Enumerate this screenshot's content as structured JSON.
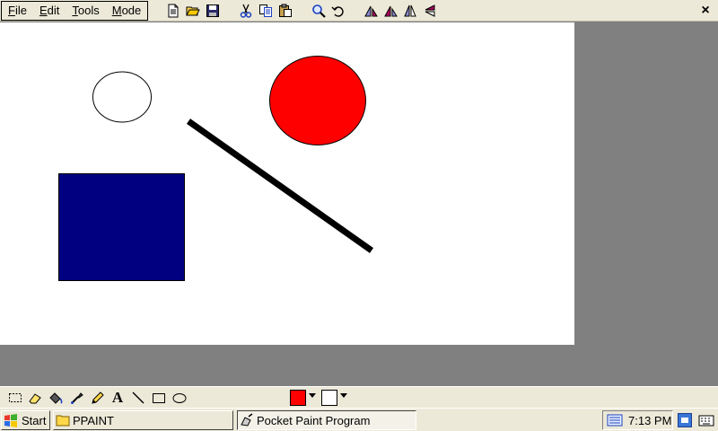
{
  "app": {
    "menu": [
      {
        "underline": "F",
        "rest": "ile"
      },
      {
        "underline": "E",
        "rest": "dit"
      },
      {
        "underline": "T",
        "rest": "ools"
      },
      {
        "underline": "M",
        "rest": "ode"
      }
    ],
    "close_label": "×"
  },
  "toolbar": {
    "buttons": [
      "new-icon",
      "open-icon",
      "save-icon",
      "cut-icon",
      "copy-icon",
      "paste-icon",
      "zoom-icon",
      "undo-icon",
      "rotate-left-icon",
      "rotate-right-icon",
      "flip-horizontal-icon",
      "flip-vertical-icon"
    ]
  },
  "canvas": {
    "shapes": [
      {
        "type": "ellipse",
        "fill": "#ffffff",
        "stroke": "#000000"
      },
      {
        "type": "ellipse",
        "fill": "#ff0000",
        "stroke": "#000000"
      },
      {
        "type": "line",
        "stroke": "#000000"
      },
      {
        "type": "rect",
        "fill": "#000080",
        "stroke": "#000000"
      }
    ]
  },
  "tools": {
    "items": [
      "select-icon",
      "eraser-icon",
      "fill-icon",
      "eyedropper-icon",
      "pencil-icon",
      "text-icon",
      "line-icon",
      "rectangle-icon",
      "ellipse-icon"
    ],
    "text_glyph": "A",
    "foreground_color": "#ff0000",
    "background_color": "#ffffff"
  },
  "taskbar": {
    "start_label": "Start",
    "folder_task": "PPAINT",
    "app_task": "Pocket Paint Program",
    "clock": "7:13 PM"
  }
}
